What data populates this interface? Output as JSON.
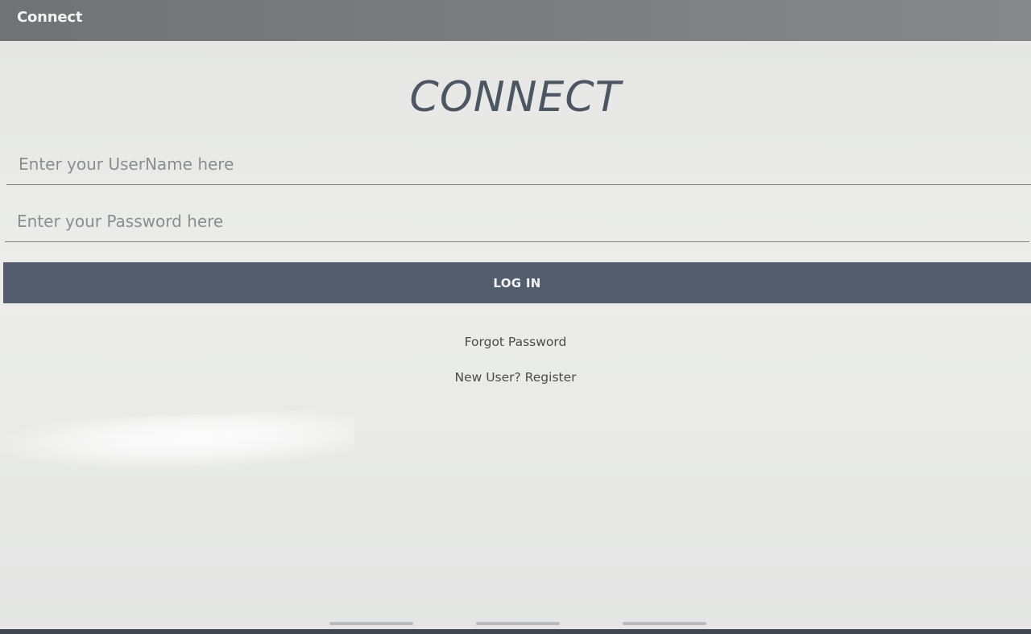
{
  "app_bar": {
    "title": "Connect"
  },
  "login": {
    "heading": "CONNECT",
    "username": {
      "placeholder": "Enter your UserName here",
      "value": ""
    },
    "password": {
      "placeholder": "Enter your Password here",
      "value": ""
    },
    "login_label": "LOG IN",
    "forgot_password_label": "Forgot Password",
    "register_label": "New User? Register"
  },
  "colors": {
    "app_bar": "#777b7c",
    "background": "#e9eae8",
    "heading": "#4d5663",
    "login_button": "#545d6e",
    "login_button_text": "#f2f3f5",
    "link_text": "#4a4a4a"
  }
}
